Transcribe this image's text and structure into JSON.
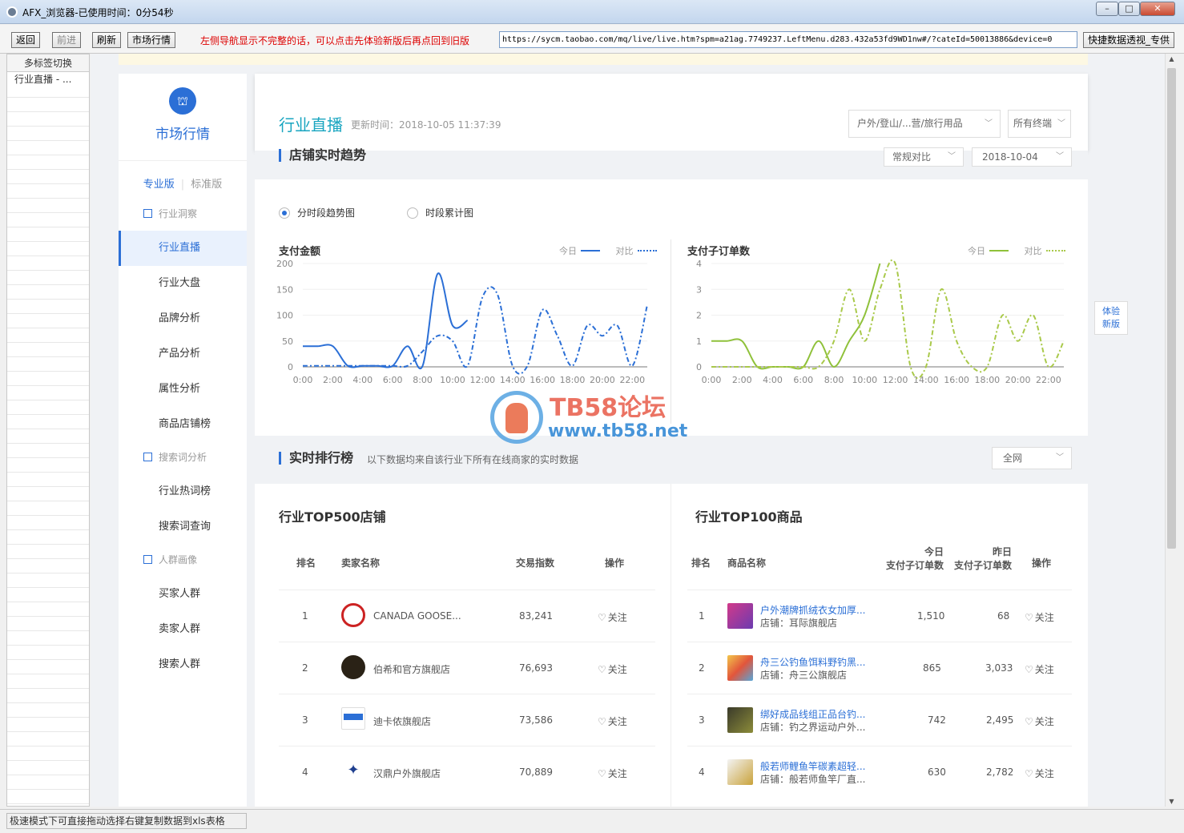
{
  "window": {
    "title": "AFX_浏览器-已使用时间：0分54秒"
  },
  "toolbar": {
    "back": "返回",
    "forward": "前进",
    "refresh": "刷新",
    "market": "市场行情",
    "notice": "左侧导航显示不完整的话，可以点击先体验新版后再点回到旧版",
    "url": "https://sycm.taobao.com/mq/live/live.htm?spm=a21ag.7749237.LeftMenu.d283.432a53fd9WD1nw#/?cateId=50013886&device=0",
    "quick": "快捷数据透视_专供"
  },
  "tabs": {
    "header": "多标签切换",
    "items": [
      "行业直播 - ..."
    ]
  },
  "status": "极速模式下可直接拖动选择右键复制数据到xls表格",
  "nav": {
    "title": "市场行情",
    "pro": "专业版",
    "std": "标准版",
    "groups": [
      "行业洞察",
      "搜索词分析",
      "人群画像"
    ],
    "items": [
      "行业直播",
      "行业大盘",
      "品牌分析",
      "产品分析",
      "属性分析",
      "商品店铺榜",
      "行业热词榜",
      "搜索词查询",
      "买家人群",
      "卖家人群",
      "搜索人群"
    ]
  },
  "header": {
    "title": "行业直播",
    "update": "更新时间：2018-10-05 11:37:39",
    "category": "户外/登山/...营/旅行用品",
    "terminal": "所有终端"
  },
  "trend": {
    "title": "店铺实时趋势",
    "compare": "常规对比",
    "date": "2018-10-04",
    "radio1": "分时段趋势图",
    "radio2": "时段累计图",
    "legend_today": "今日",
    "legend_compare": "对比"
  },
  "chart_data": [
    {
      "type": "line",
      "title": "支付金额",
      "x": [
        "0:00",
        "1:00",
        "2:00",
        "3:00",
        "4:00",
        "5:00",
        "6:00",
        "7:00",
        "8:00",
        "9:00",
        "10:00",
        "11:00",
        "12:00",
        "13:00",
        "14:00",
        "15:00",
        "16:00",
        "17:00",
        "18:00",
        "19:00",
        "20:00",
        "21:00",
        "22:00",
        "23:00"
      ],
      "x_ticks": [
        "0:00",
        "2:00",
        "4:00",
        "6:00",
        "8:00",
        "10:00",
        "12:00",
        "14:00",
        "16:00",
        "18:00",
        "20:00",
        "22:00"
      ],
      "ylim": [
        0,
        200
      ],
      "y_ticks": [
        "0",
        "50",
        "100",
        "150",
        "200"
      ],
      "series": [
        {
          "name": "今日",
          "color": "#2b6fd6",
          "values": [
            40,
            40,
            40,
            2,
            2,
            2,
            2,
            40,
            2,
            180,
            80,
            90
          ]
        },
        {
          "name": "对比",
          "color": "#2b6fd6",
          "values": [
            2,
            2,
            2,
            2,
            2,
            2,
            2,
            2,
            30,
            60,
            50,
            2,
            135,
            140,
            2,
            2,
            110,
            60,
            2,
            80,
            60,
            80,
            2,
            120
          ]
        }
      ]
    },
    {
      "type": "line",
      "title": "支付子订单数",
      "x": [
        "0:00",
        "1:00",
        "2:00",
        "3:00",
        "4:00",
        "5:00",
        "6:00",
        "7:00",
        "8:00",
        "9:00",
        "10:00",
        "11:00",
        "12:00",
        "13:00",
        "14:00",
        "15:00",
        "16:00",
        "17:00",
        "18:00",
        "19:00",
        "20:00",
        "21:00",
        "22:00",
        "23:00"
      ],
      "x_ticks": [
        "0:00",
        "2:00",
        "4:00",
        "6:00",
        "8:00",
        "10:00",
        "12:00",
        "14:00",
        "16:00",
        "18:00",
        "20:00",
        "22:00"
      ],
      "ylim": [
        0,
        4
      ],
      "y_ticks": [
        "0",
        "1",
        "2",
        "3",
        "4"
      ],
      "series": [
        {
          "name": "今日",
          "color": "#8fc13a",
          "values": [
            1,
            1,
            1,
            0,
            0,
            0,
            0,
            1,
            0,
            1,
            2,
            4
          ]
        },
        {
          "name": "对比",
          "color": "#a9c94a",
          "values": [
            0,
            0,
            0,
            0,
            0,
            0,
            0,
            0,
            1,
            3,
            1,
            3,
            4,
            0,
            0,
            3,
            1,
            0,
            0,
            2,
            1,
            2,
            0,
            1
          ]
        }
      ]
    }
  ],
  "ranking": {
    "title": "实时排行榜",
    "subtitle": "以下数据均来自该行业下所有在线商家的实时数据",
    "scope": "全网"
  },
  "shops": {
    "title": "行业TOP500店铺",
    "headers": [
      "排名",
      "卖家名称",
      "交易指数",
      "操作"
    ],
    "rows": [
      {
        "rank": "1",
        "name": "CANADA GOOSE...",
        "index": "83,241",
        "action": "关注"
      },
      {
        "rank": "2",
        "name": "伯希和官方旗舰店",
        "index": "76,693",
        "action": "关注"
      },
      {
        "rank": "3",
        "name": "迪卡侬旗舰店",
        "index": "73,586",
        "action": "关注"
      },
      {
        "rank": "4",
        "name": "汉鼎户外旗舰店",
        "index": "70,889",
        "action": "关注"
      }
    ]
  },
  "products": {
    "title": "行业TOP100商品",
    "headers": [
      "排名",
      "商品名称",
      "今日",
      "支付子订单数",
      "昨日",
      "支付子订单数",
      "操作"
    ],
    "rows": [
      {
        "rank": "1",
        "name": "户外潮牌抓绒衣女加厚...",
        "shop": "店铺：耳际旗舰店",
        "today": "1,510",
        "yesterday": "68",
        "action": "关注"
      },
      {
        "rank": "2",
        "name": "舟三公钓鱼饵料野钓黑...",
        "shop": "店铺：舟三公旗舰店",
        "today": "865",
        "yesterday": "3,033",
        "action": "关注"
      },
      {
        "rank": "3",
        "name": "绑好成品线组正品台钓...",
        "shop": "店铺：钓之界运动户外...",
        "today": "742",
        "yesterday": "2,495",
        "action": "关注"
      },
      {
        "rank": "4",
        "name": "般若师鲤鱼竿碳素超轻...",
        "shop": "店铺：般若师鱼竿厂直...",
        "today": "630",
        "yesterday": "2,782",
        "action": "关注"
      }
    ]
  },
  "side": {
    "exp1": "体验",
    "exp2": "新版"
  },
  "watermark": {
    "text1": "TB58论坛",
    "text2": "www.tb58.net"
  },
  "colors": {
    "accent": "#2b6fd6",
    "title": "#19a5c0",
    "green": "#8fc13a"
  }
}
